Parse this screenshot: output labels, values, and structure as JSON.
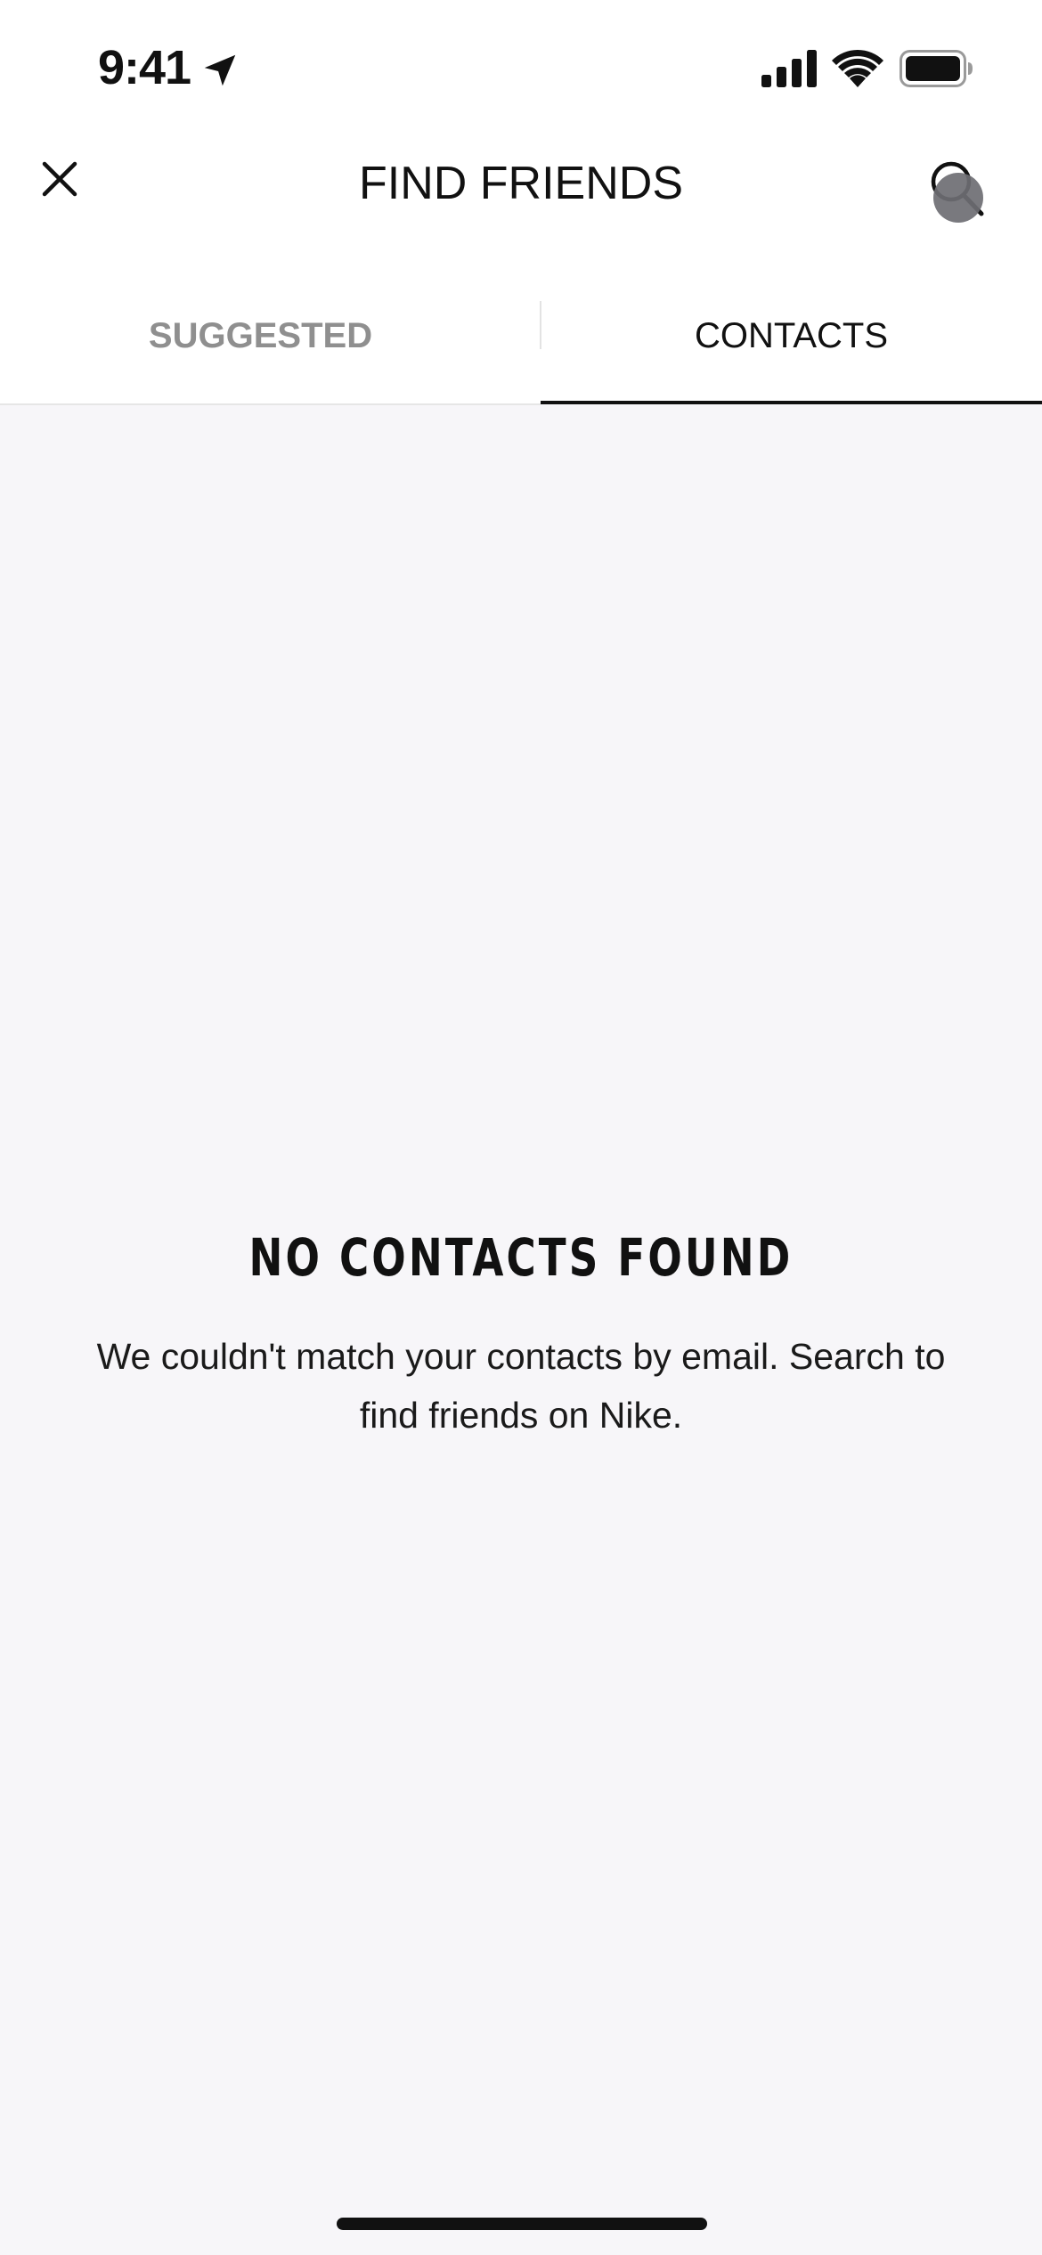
{
  "status_bar": {
    "time": "9:41",
    "location_icon": "location-arrow-icon",
    "signal_icon": "cellular-signal-icon",
    "wifi_icon": "wifi-icon",
    "battery_icon": "battery-icon"
  },
  "header": {
    "title": "FIND FRIENDS",
    "close_icon": "close-icon",
    "search_icon": "search-icon"
  },
  "tabs": [
    {
      "label": "SUGGESTED",
      "active": false
    },
    {
      "label": "CONTACTS",
      "active": true
    }
  ],
  "empty_state": {
    "title": "NO CONTACTS FOUND",
    "message": "We couldn't match your contacts by email. Search to find friends on Nike."
  },
  "colors": {
    "background": "#f7f6f9",
    "surface": "#ffffff",
    "text": "#111111",
    "inactive_tab": "#8f8f8f"
  }
}
